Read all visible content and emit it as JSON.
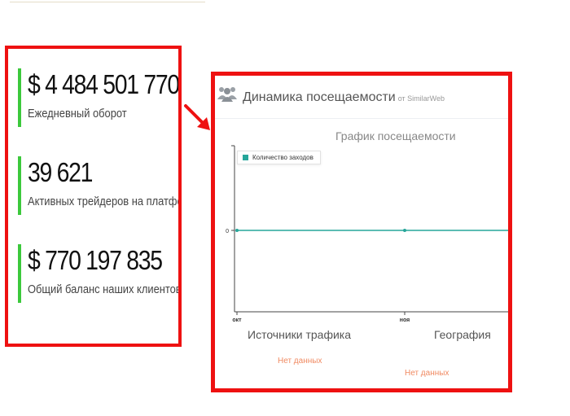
{
  "stats": [
    {
      "value": "$ 4 484 501 770",
      "label": "Ежедневный оборот"
    },
    {
      "value": "39 621",
      "label": "Активных трейдеров на платформе"
    },
    {
      "value": "$ 770 197 835",
      "label": "Общий баланс наших клиентов"
    }
  ],
  "panel": {
    "title": "Динамика посещаемости",
    "source": "от SimilarWeb",
    "icon": "users-icon"
  },
  "chart_data": {
    "type": "line",
    "title": "График посещаемости",
    "categories": [
      "окт",
      "ноя"
    ],
    "series": [
      {
        "name": "Количество заходов",
        "values": [
          0,
          0
        ]
      }
    ],
    "y_ticks": [
      "0"
    ],
    "series_color": "#26a69a",
    "legend": "top-left",
    "grid": false
  },
  "sections": [
    {
      "title": "Источники трафика",
      "no_data": "Нет данных"
    },
    {
      "title": "География",
      "no_data": "Нет данных"
    }
  ],
  "colors": {
    "highlight_border": "#ee1111",
    "stat_accent": "#3cc93c",
    "no_data": "#f08a62"
  }
}
